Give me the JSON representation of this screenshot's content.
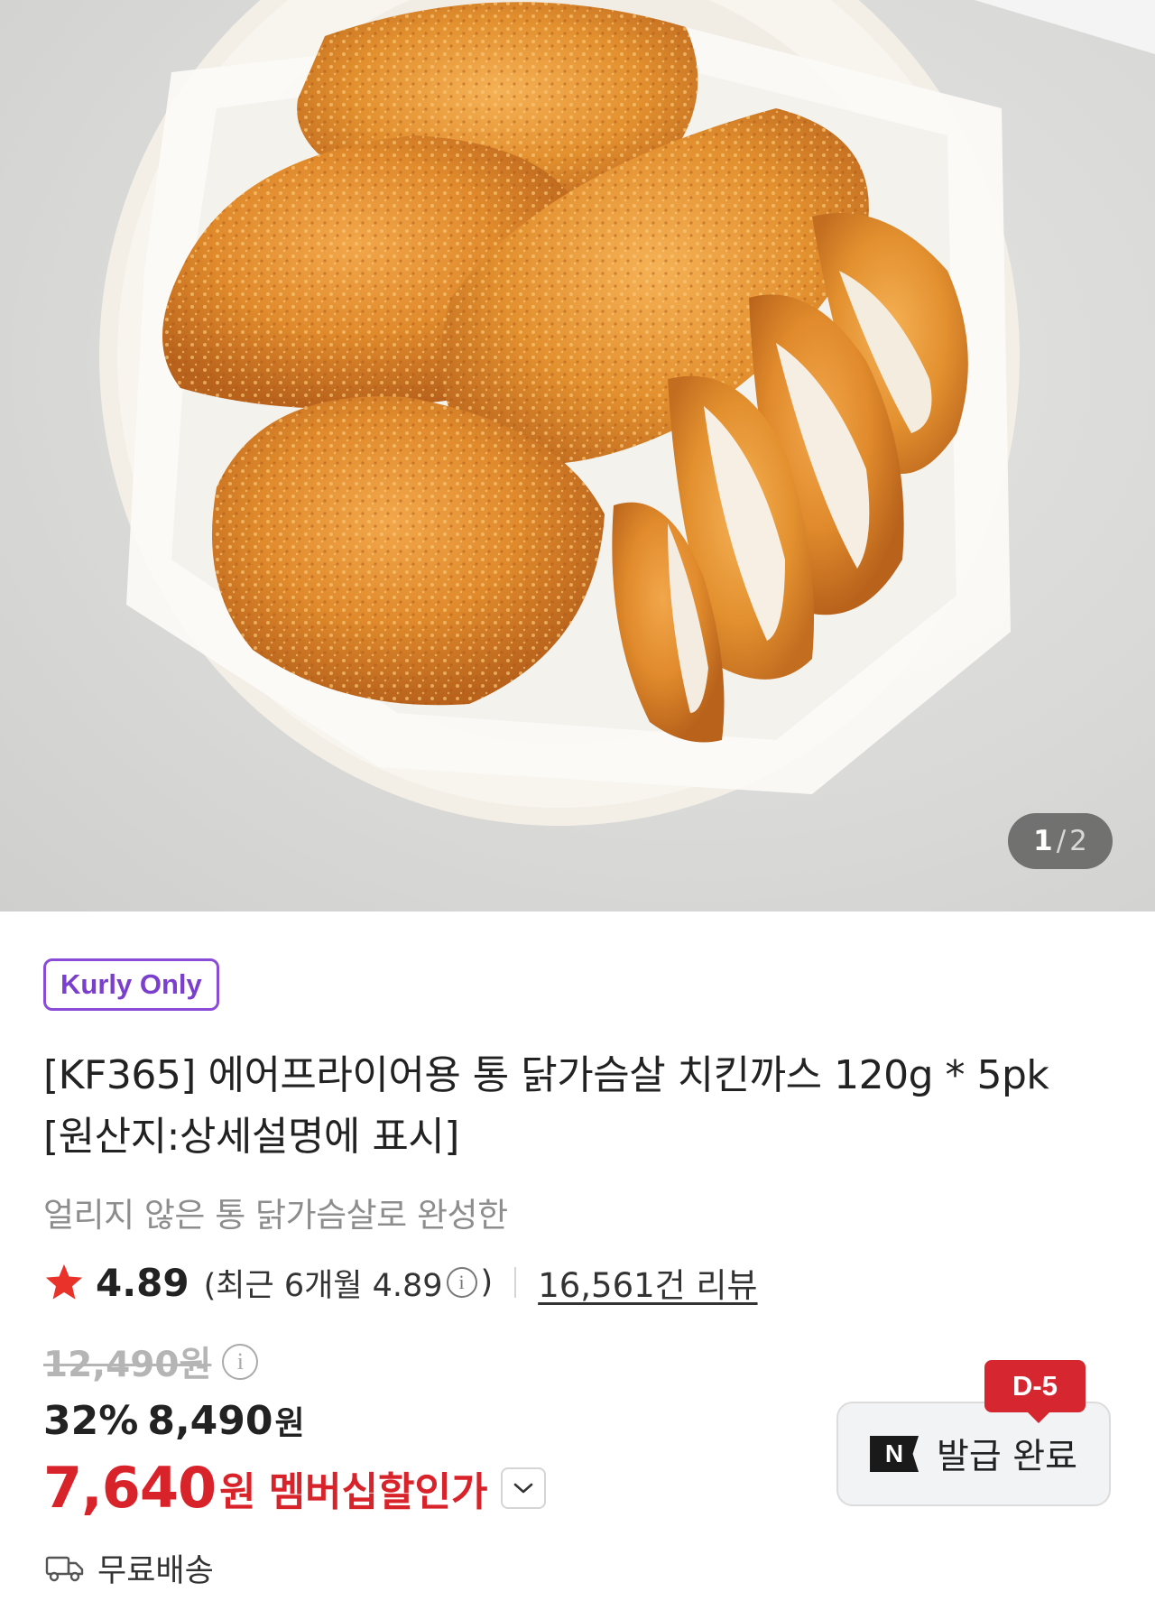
{
  "gallery": {
    "current_page": "1",
    "separator": "/",
    "total_pages": "2",
    "image_icon": "fried-chicken-cutlet-photo"
  },
  "product": {
    "badge": "Kurly Only",
    "title_line1": "[KF365] 에어프라이어용 통 닭가슴살 치킨까스 120g * 5pk",
    "title_line2": "[원산지:상세설명에 표시]",
    "subtitle": "얼리지 않은 통 닭가슴살로 완성한"
  },
  "rating": {
    "star_icon": "star-icon",
    "score": "4.89",
    "recent_prefix": "(최근 6개월 4.89",
    "recent_suffix": ")",
    "info_icon": "i",
    "reviews": "16,561건 리뷰"
  },
  "price": {
    "original": "12,490원",
    "info_icon": "i",
    "discount": "32%",
    "sale_price": "8,490",
    "sale_unit": "원",
    "member_price": "7,640",
    "member_unit": "원",
    "member_label": "멤버십할인가"
  },
  "coupon": {
    "logo": "N",
    "label": "발급 완료",
    "dday": "D-5"
  },
  "delivery": {
    "icon": "truck-icon",
    "text": "무료배송"
  },
  "colors": {
    "accent_red": "#d8232a",
    "kurly_purple": "#7b3fce",
    "dday_red": "#d62630"
  }
}
